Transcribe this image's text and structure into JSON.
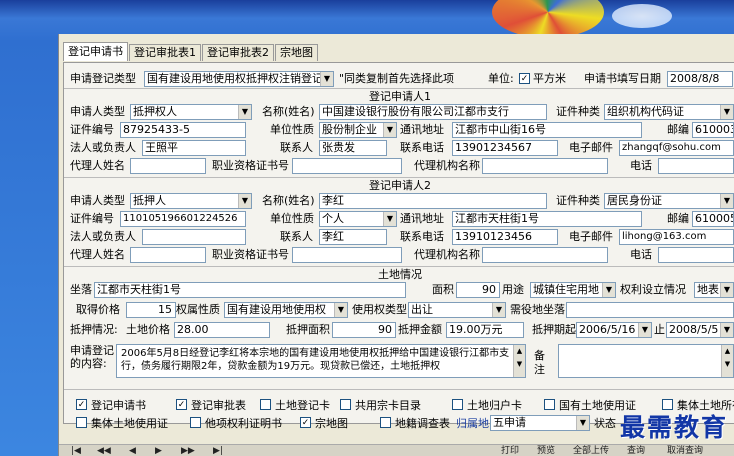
{
  "tabs": [
    "登记申请书",
    "登记审批表1",
    "登记审批表2",
    "宗地图"
  ],
  "top": {
    "reg_type_label": "申请登记类型",
    "reg_type_value": "国有建设用地使用权抵押权注销登记",
    "note": "\"同类复制首先选择此项",
    "unit_label": "单位:",
    "unit_value": "平方米",
    "date_label": "申请书填写日期",
    "date_value": "2008/8/8"
  },
  "section1": "登记申请人1",
  "app1": {
    "type_label": "申请人类型",
    "type_value": "抵押权人",
    "name_label": "名称(姓名)",
    "name_value": "中国建设银行股份有限公司江都市支行",
    "idtype_label": "证件种类",
    "idtype_value": "组织机构代码证",
    "idno_label": "证件编号",
    "idno_value": "87925433-5",
    "unit_label": "单位性质",
    "unit_value": "股份制企业",
    "addr_label": "通讯地址",
    "addr_value": "江都市中山街16号",
    "zip_label": "邮编",
    "zip_value": "610003",
    "legal_label": "法人或负责人",
    "legal_value": "王照平",
    "contact_label": "联系人",
    "contact_value": "张贵发",
    "tel_label": "联系电话",
    "tel_value": "13901234567",
    "email_label": "电子邮件",
    "email_value": "zhangqf@sohu.com",
    "agent_label": "代理人姓名",
    "cert_label": "职业资格证书号",
    "agency_label": "代理机构名称",
    "phone_label": "电话"
  },
  "section2": "登记申请人2",
  "app2": {
    "type_label": "申请人类型",
    "type_value": "抵押人",
    "name_label": "名称(姓名)",
    "name_value": "李红",
    "idtype_label": "证件种类",
    "idtype_value": "居民身份证",
    "idno_label": "证件编号",
    "idno_value": "110105196601224526",
    "unit_label": "单位性质",
    "unit_value": "个人",
    "addr_label": "通讯地址",
    "addr_value": "江都市天柱街1号",
    "zip_label": "邮编",
    "zip_value": "610005",
    "legal_label": "法人或负责人",
    "contact_label": "联系人",
    "contact_value": "李红",
    "tel_label": "联系电话",
    "tel_value": "13910123456",
    "email_label": "电子邮件",
    "email_value": "lihong@163.com",
    "agent_label": "代理人姓名",
    "cert_label": "职业资格证书号",
    "agency_label": "代理机构名称",
    "phone_label": "电话"
  },
  "section3": "土地情况",
  "land": {
    "loc_label": "坐落",
    "loc_value": "江都市天柱街1号",
    "area_label": "面积",
    "area_value": "90",
    "use_label": "用途",
    "use_value": "城镇住宅用地",
    "right_label": "权利设立情况",
    "right_value": "地表",
    "price_label": "取得价格",
    "price_value": "15",
    "ownership_label": "权属性质",
    "ownership_value": "国有建设用地使用权",
    "usetype_label": "使用权类型",
    "usetype_value": "出让",
    "need_label": "需役地坐落",
    "mort_label": "抵押情况:",
    "lprice_label": "土地价格",
    "lprice_value": "28.00",
    "marea_label": "抵押面积",
    "marea_value": "90",
    "mamt_label": "抵押金额",
    "mamt_value": "19.00万元",
    "period_label": "抵押期起",
    "period_from": "2006/5/16",
    "period_to_label": "止",
    "period_to": "2008/5/5"
  },
  "content": {
    "label1": "申请登记",
    "label2": "的内容:",
    "text": "2006年5月8日经登记李红将本宗地的国有建设用地使用权抵押给中国建设银行江都市支行，债务履行期限2年，贷款金额为19万元。现贷款已偿还，土地抵押权",
    "remark1": "备",
    "remark2": "注"
  },
  "checks1": [
    {
      "label": "登记申请书",
      "on": true
    },
    {
      "label": "登记审批表",
      "on": true
    },
    {
      "label": "土地登记卡",
      "on": false
    },
    {
      "label": "共用宗卡目录",
      "on": false
    },
    {
      "label": "土地归户卡",
      "on": false
    },
    {
      "label": "国有土地使用证",
      "on": false
    },
    {
      "label": "集体土地所有证",
      "on": false
    }
  ],
  "checks2": [
    {
      "label": "集体土地使用证",
      "on": false
    },
    {
      "label": "他项权利证明书",
      "on": false
    },
    {
      "label": "宗地图",
      "on": true
    },
    {
      "label": "地籍调查表",
      "on": false
    }
  ],
  "attr_label": "归属地",
  "attr_value": "五申请",
  "status_label": "状态",
  "toolbar": [
    "打印",
    "预览",
    "全部上传",
    "查询",
    "取消查询"
  ],
  "watermark": "最需教育"
}
